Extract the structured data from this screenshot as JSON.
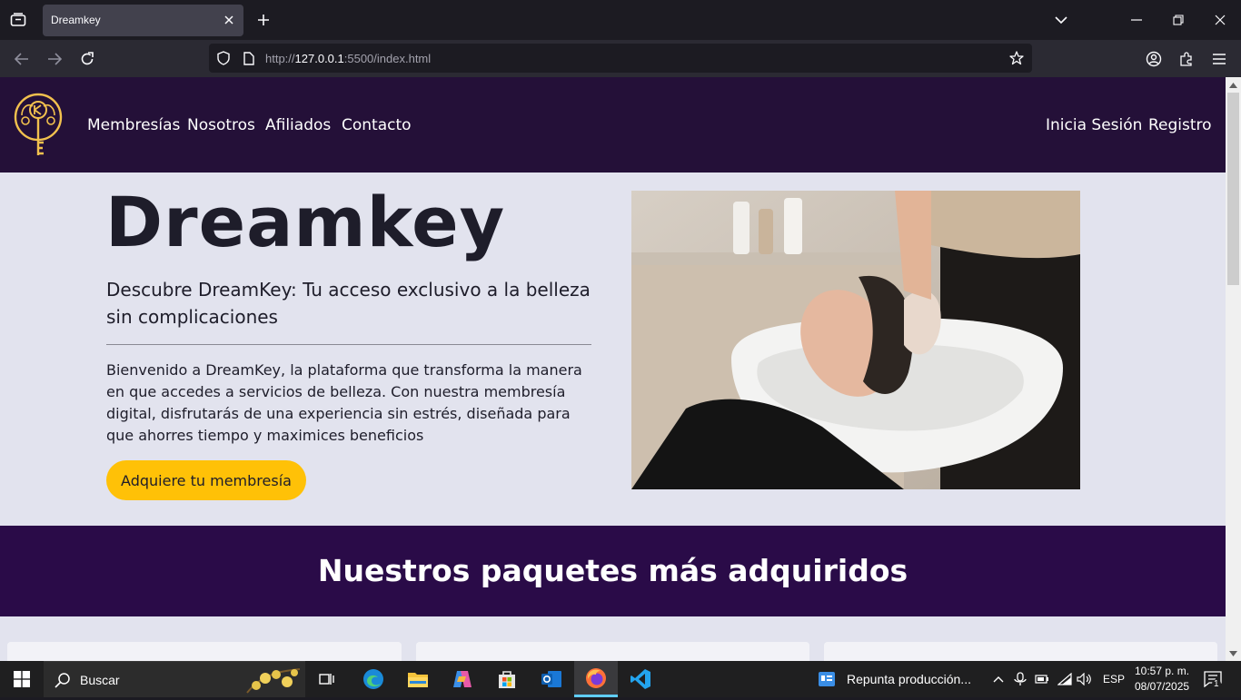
{
  "browser": {
    "tab_title": "Dreamkey",
    "url_prefix": "http://",
    "url_host": "127.0.0.1",
    "url_rest": ":5500/index.html"
  },
  "site": {
    "nav_left": [
      "Membresías",
      "Nosotros",
      "Afiliados",
      "Contacto"
    ],
    "nav_right": [
      "Inicia Sesión",
      "Registro"
    ],
    "hero_title": "Dreamkey",
    "hero_subtitle": "Descubre DreamKey: Tu acceso exclusivo a la belleza sin complicaciones",
    "hero_body": "Bienvenido a DreamKey, la plataforma que transforma la manera en que accedes a servicios de belleza. Con nuestra membresía digital, disfrutarás de una experiencia sin estrés, diseñada para que ahorres tiempo y maximices beneficios",
    "cta_label": "Adquiere tu membresía",
    "packages_title": "Nuestros paquetes más adquiridos",
    "colors": {
      "header_bg": "#241038",
      "band_bg": "#2a0b48",
      "cta_bg": "#ffc107",
      "logo_gold": "#f2c14e",
      "page_bg": "#e2e3ee"
    }
  },
  "taskbar": {
    "search_placeholder": "Buscar",
    "notification_text": "Repunta producción...",
    "language": "ESP",
    "time": "10:57 p. m.",
    "date": "08/07/2025",
    "notification_count": "1"
  }
}
